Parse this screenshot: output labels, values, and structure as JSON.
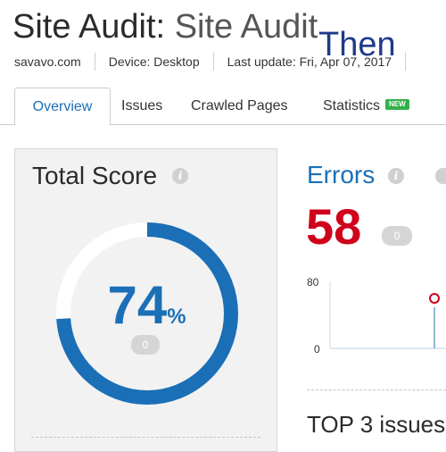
{
  "header": {
    "title_main": "Site Audit:",
    "title_project": "Site Audit",
    "overlay_text": "Then",
    "domain": "savavo.com",
    "device": "Device: Desktop",
    "last_update": "Last update: Fri, Apr 07, 2017"
  },
  "tabs": [
    {
      "label": "Overview",
      "active": true
    },
    {
      "label": "Issues"
    },
    {
      "label": "Crawled Pages"
    },
    {
      "label": "Statistics",
      "badge": "NEW"
    }
  ],
  "total_score": {
    "title": "Total Score",
    "value": "74",
    "unit": "%",
    "change": "0",
    "fraction": 0.74
  },
  "errors": {
    "title": "Errors",
    "value": "58",
    "change": "0",
    "axis_max": "80",
    "axis_min": "0"
  },
  "top_issues": {
    "title": "TOP 3 issues"
  },
  "colors": {
    "accent": "#1b6fb6",
    "error": "#d0021b",
    "new_badge": "#33b04a"
  }
}
